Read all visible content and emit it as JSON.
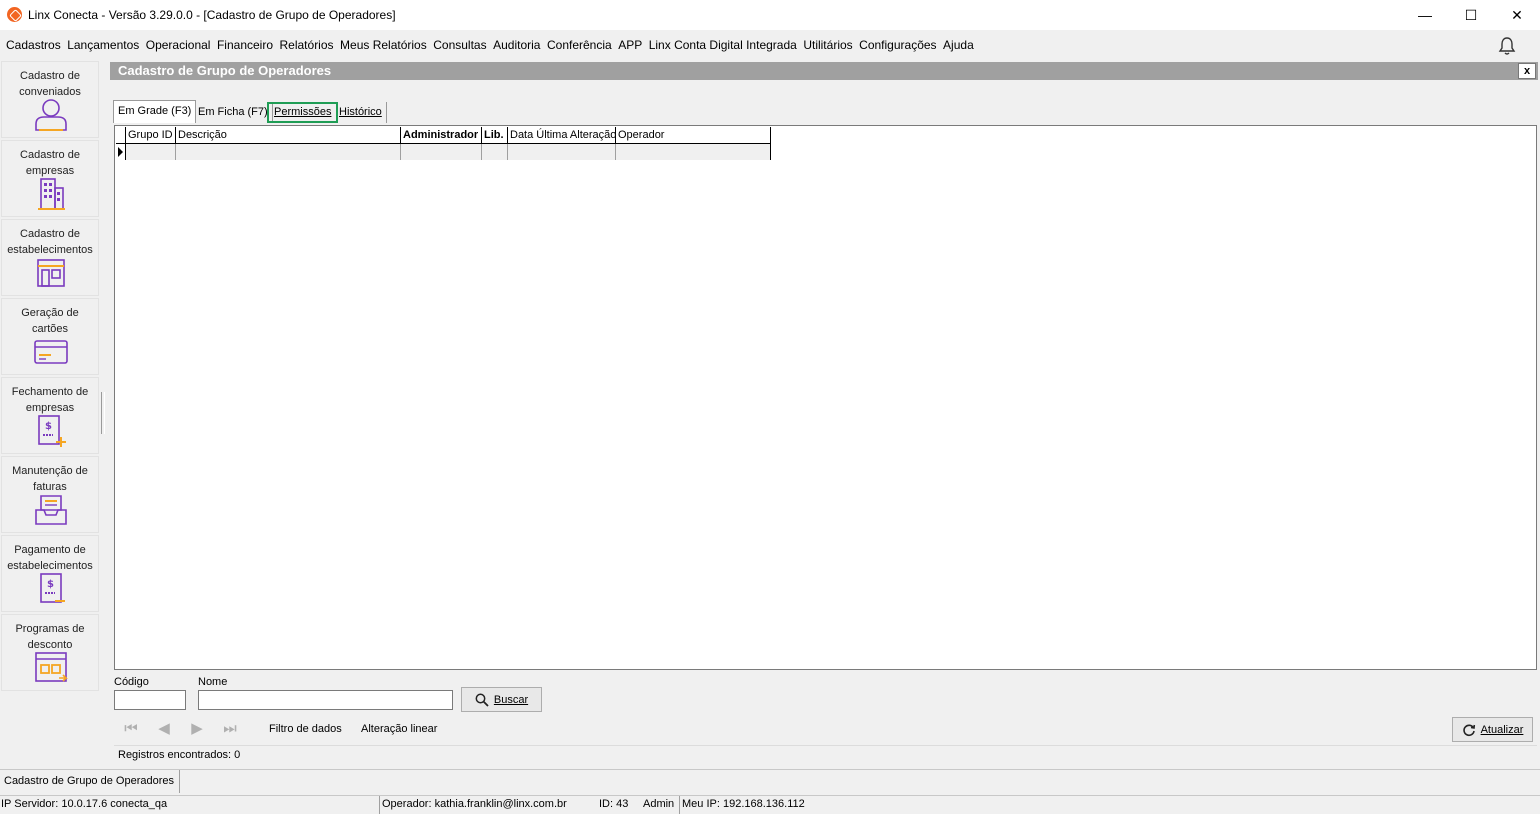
{
  "window": {
    "title": "Linx Conecta - Versão 3.29.0.0 - [Cadastro de Grupo de Operadores]",
    "minimize_glyph": "—",
    "maximize_glyph": "☐",
    "close_glyph": "✕"
  },
  "menu": [
    "Cadastros",
    "Lançamentos",
    "Operacional",
    "Financeiro",
    "Relatórios",
    "Meus Relatórios",
    "Consultas",
    "Auditoria",
    "Conferência",
    "APP",
    "Linx Conta Digital Integrada",
    "Utilitários",
    "Configurações",
    "Ajuda"
  ],
  "sidebar": {
    "items": [
      {
        "label": "Cadastro de conveniados",
        "icon": "user-icon"
      },
      {
        "label": "Cadastro de empresas",
        "icon": "building-icon"
      },
      {
        "label": "Cadastro de estabelecimentos",
        "icon": "store-icon"
      },
      {
        "label": "Geração de cartões",
        "icon": "card-icon"
      },
      {
        "label": "Fechamento de empresas",
        "icon": "invoice-plus-icon"
      },
      {
        "label": "Manutenção de faturas",
        "icon": "inbox-tray-icon"
      },
      {
        "label": "Pagamento de estabelecimentos",
        "icon": "invoice-minus-icon"
      },
      {
        "label": "Programas de desconto",
        "icon": "discount-program-icon"
      }
    ]
  },
  "form": {
    "title": "Cadastro de Grupo de Operadores",
    "close_label": "x"
  },
  "tabs": [
    "Em Grade (F3)",
    "Em Ficha (F7)",
    "Permissões",
    "Histórico"
  ],
  "grid": {
    "columns": [
      "Grupo ID",
      "Descrição",
      "Administrador",
      "Lib.",
      "Data Última Alteração",
      "Operador"
    ]
  },
  "filters": {
    "code_label": "Código",
    "code_value": "",
    "name_label": "Nome",
    "name_value": "",
    "search_button": "Buscar"
  },
  "toolbar": {
    "data_filter": "Filtro de dados",
    "linear_change": "Alteração linear",
    "refresh_button": "Atualizar"
  },
  "records_found": "Registros encontrados: 0",
  "status": {
    "form_name": "Cadastro de Grupo de Operadores",
    "server_ip": "IP Servidor: 10.0.17.6 conecta_qa",
    "operator": "Operador: kathia.franklin@linx.com.br",
    "id": "ID: 43",
    "role": "Admin",
    "my_ip": "Meu IP: 192.168.136.112"
  },
  "colors": {
    "accent_purple": "#7a3bbf",
    "accent_orange": "#f5a623",
    "tab_highlight": "#1f9d55",
    "header_gray": "#a0a0a0"
  }
}
